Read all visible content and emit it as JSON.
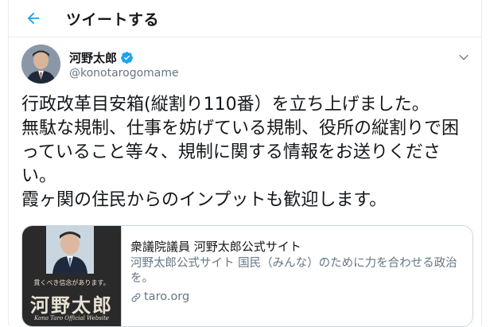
{
  "header": {
    "title": "ツイートする",
    "back_icon": "arrow-left-icon"
  },
  "author": {
    "display_name": "河野太郎",
    "handle": "@konotarogomame",
    "verified_icon": "verified-badge-icon"
  },
  "tweet": {
    "text": "行政改革目安箱(縦割り110番）を立ち上げました。\n無駄な規制、仕事を妨げている規制、役所の縦割りで困っていること等々、規制に関する情報をお送りください。\n霞ヶ関の住民からのインプットも歓迎します。"
  },
  "card": {
    "title": "衆議院議員 河野太郎公式サイト",
    "description": "河野太郎公式サイト 国民（みんな）のために力を合わせる政治を。",
    "domain": "taro.org",
    "link_icon": "link-icon",
    "thumb": {
      "tagline": "貫くべき信念があります。",
      "name": "河野太郎",
      "footer": "Kono Taro Official Website"
    }
  },
  "colors": {
    "accent": "#1da1f2",
    "text_primary": "#14171a",
    "text_secondary": "#657786",
    "border": "#e6ecf0"
  }
}
